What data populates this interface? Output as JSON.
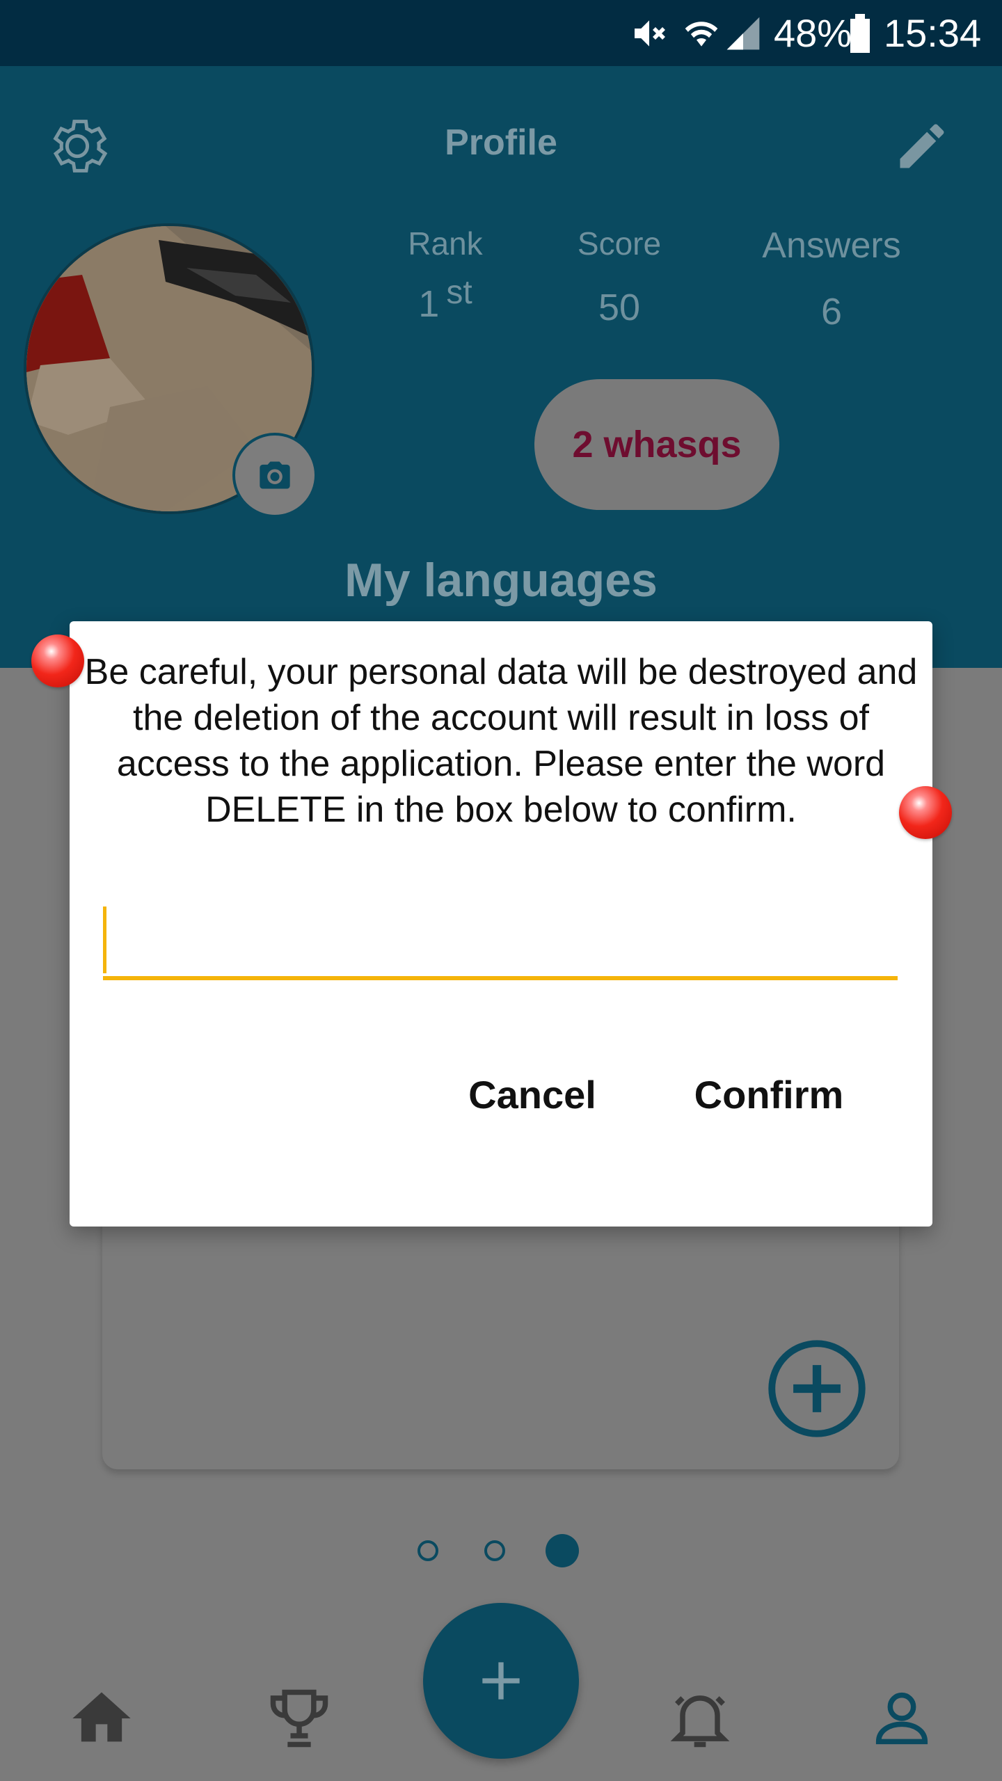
{
  "status_bar": {
    "battery_percent": "48%",
    "time": "15:34",
    "icons": [
      "mute-icon",
      "wifi-icon",
      "signal-icon",
      "battery-icon"
    ]
  },
  "header": {
    "title": "Profile",
    "settings_icon": "gear-icon",
    "edit_icon": "pencil-icon"
  },
  "stats": {
    "rank_label": "Rank",
    "rank_value": "1",
    "rank_suffix": "st",
    "score_label": "Score",
    "score_value": "50",
    "answers_label": "Answers",
    "answers_value": "6"
  },
  "whasqs_label": "2 whasqs",
  "languages_title": "My languages",
  "dialog": {
    "message": "Be careful, your personal data will be destroyed and the deletion of the account will result in loss of access to the application. Please enter the word DELETE in the box below to confirm.",
    "input_value": "",
    "cancel_label": "Cancel",
    "confirm_label": "Confirm"
  },
  "pager": {
    "page_count": 3,
    "active_index": 2
  },
  "bottom_nav": {
    "items": [
      "home-icon",
      "trophy-icon",
      "add-icon",
      "bell-icon",
      "person-icon"
    ]
  },
  "colors": {
    "accent": "#f5b40a",
    "header": "#0a4a60",
    "status_bar": "#022c42",
    "whasqs_text": "#6e0d2f"
  }
}
